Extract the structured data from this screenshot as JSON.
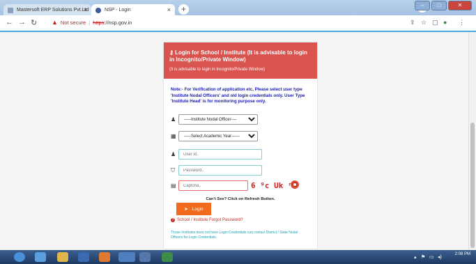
{
  "browser": {
    "tabs": [
      {
        "title": "Mastersoft ERP Solutions Pvt.Ltd",
        "close": "×"
      },
      {
        "title": "NSP - Login",
        "close": "×"
      }
    ],
    "new_tab": "+",
    "url_warning": "Not secure",
    "url_protocol": "https",
    "url_rest": "://nsp.gov.in"
  },
  "card": {
    "title": "Login for School / Institute (It is advisable to login in Incognito/Private Window)",
    "subtitle": "(It is advisable to login in Incognito/Private Window)",
    "note": "Note:- For Verification of application etc, Please select user type 'Institute Nodal Officers' and old login credentials only. User Type 'Institute Head' is for monitoring purpose only.",
    "user_type_selected": "-----Institute Nodal Officer----",
    "academic_year_selected": "-----Select Academic Year------",
    "user_id_placeholder": "User id..",
    "password_placeholder": "Password..",
    "captcha_placeholder": "Captcha..",
    "captcha_text": "6 ⁹c Uk ʳ",
    "cant_see": "Can't See? Click on Refresh Button.",
    "login_label": "Login",
    "forgot_label": "School / Institute Forgot Password?",
    "info_text": "Those Institutes does not have Login Credentials can contact District / State Nodal Officers for Login Credentials."
  },
  "taskbar": {
    "time": "2:08 PM"
  }
}
